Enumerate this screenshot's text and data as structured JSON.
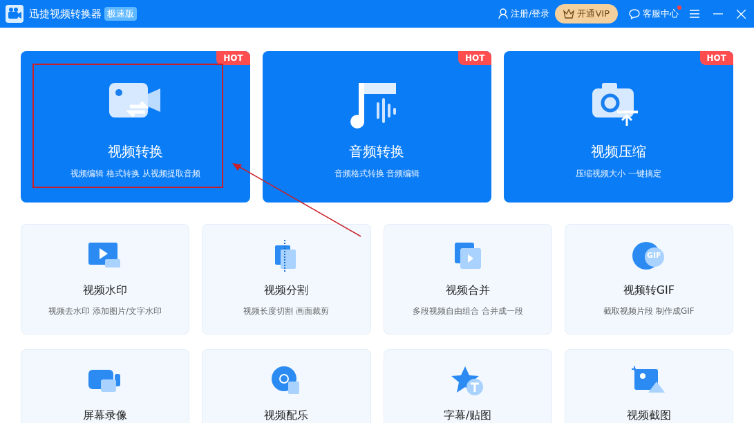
{
  "window": {
    "title": "迅捷视频转换器",
    "edition": "极速版"
  },
  "header": {
    "login": "注册/登录",
    "vip": "开通VIP",
    "support": "客服中心",
    "support_notification": true
  },
  "main_tools": [
    {
      "title": "视频转换",
      "desc": "视频编辑 格式转换 从视频提取音频",
      "badge": "HOT"
    },
    {
      "title": "音频转换",
      "desc": "音频格式转换 音频编辑",
      "badge": "HOT"
    },
    {
      "title": "视频压缩",
      "desc": "压缩视频大小 一键搞定",
      "badge": "HOT"
    }
  ],
  "tools": [
    {
      "title": "视频水印",
      "desc": "视频去水印 添加图片/文字水印"
    },
    {
      "title": "视频分割",
      "desc": "视频长度切割 画面裁剪"
    },
    {
      "title": "视频合并",
      "desc": "多段视频自由组合 合并成一段"
    },
    {
      "title": "视频转GIF",
      "desc": "截取视频片段 制作成GIF",
      "icon_label": "GIF"
    },
    {
      "title": "屏幕录像"
    },
    {
      "title": "视频配乐"
    },
    {
      "title": "字幕/贴图"
    },
    {
      "title": "视频截图"
    }
  ]
}
